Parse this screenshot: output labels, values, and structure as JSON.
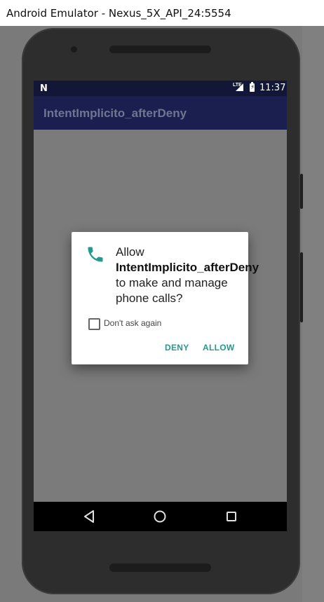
{
  "window": {
    "title": "Android Emulator - Nexus_5X_API_24:5554"
  },
  "statusbar": {
    "notification_icon": "n-icon",
    "network_label": "LTE",
    "time": "11:37"
  },
  "app": {
    "title": "IntentImplicito_afterDeny"
  },
  "dialog": {
    "message_prefix": "Allow ",
    "app_name": "IntentImplicito_afterDeny",
    "message_suffix": " to make and manage phone calls?",
    "checkbox_label": "Don't ask again",
    "checkbox_checked": false,
    "deny_label": "DENY",
    "allow_label": "ALLOW",
    "accent_color": "#229a8e",
    "icon": "phone-icon"
  },
  "navbar": {
    "back_icon": "back-triangle-icon",
    "home_icon": "home-circle-icon",
    "recents_icon": "recents-square-icon"
  }
}
